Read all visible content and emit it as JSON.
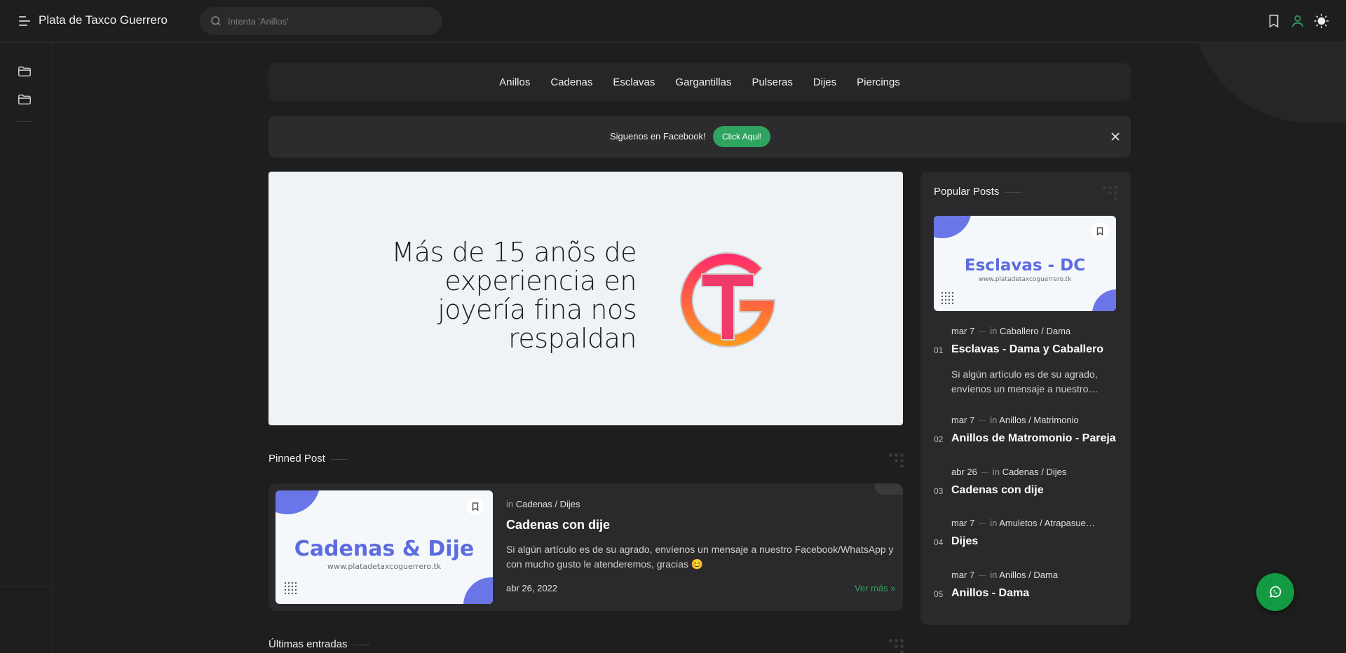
{
  "header": {
    "site_title": "Plata de Taxco Guerrero",
    "search_placeholder": "Intenta 'Anillos'"
  },
  "nav": {
    "links": [
      "Anillos",
      "Cadenas",
      "Esclavas",
      "Gargantillas",
      "Pulseras",
      "Dijes",
      "Piercings"
    ]
  },
  "notice": {
    "text": "Siguenos en Facebook!",
    "button": "Click Aqui!"
  },
  "hero": {
    "lines": [
      "Más de 15 anõs de",
      "experiencia en",
      "joyería fina nos",
      "respaldan"
    ],
    "logo_colors": [
      "#ff2a6d",
      "#ff9a1a"
    ]
  },
  "pinned": {
    "section_title": "Pinned Post",
    "thumb_brand": "Cadenas & Dije",
    "thumb_url": "www.platadetaxcoguerrero.tk",
    "meta_in": "in",
    "category": "Cadenas / Dijes",
    "title": "Cadenas con dije",
    "snippet": "Si algún artículo es de su agrado, envíenos un mensaje a nuestro Facebook/WhatsApp y con mucho gusto le atenderemos, gracias 😊",
    "date": "abr 26, 2022",
    "more": "Ver más »"
  },
  "latest": {
    "section_title": "Últimas entradas"
  },
  "popular": {
    "title": "Popular Posts",
    "thumb_brand": "Esclavas - DC",
    "thumb_url": "www.platadetaxcoguerrero.tk",
    "items": [
      {
        "num": "01",
        "date": "mar 7",
        "in": "in",
        "category": "Caballero / Dama",
        "title": "Esclavas - Dama y Caballero",
        "snippet": "Si algún artículo es de su agrado, envíenos un mensaje a nuestro…"
      },
      {
        "num": "02",
        "date": "mar 7",
        "in": "in",
        "category": "Anillos / Matrimonio",
        "title": "Anillos de Matromonio - Pareja"
      },
      {
        "num": "03",
        "date": "abr 26",
        "in": "in",
        "category": "Cadenas / Dijes",
        "title": "Cadenas con dije"
      },
      {
        "num": "04",
        "date": "mar 7",
        "in": "in",
        "category": "Amuletos / Atrapasue…",
        "title": "Dijes"
      },
      {
        "num": "05",
        "date": "mar 7",
        "in": "in",
        "category": "Anillos / Dama",
        "title": "Anillos - Dama"
      }
    ]
  },
  "colors": {
    "accent_green": "#2fa360",
    "whatsapp": "#139a43",
    "thumb_blue": "#6a75e8"
  }
}
